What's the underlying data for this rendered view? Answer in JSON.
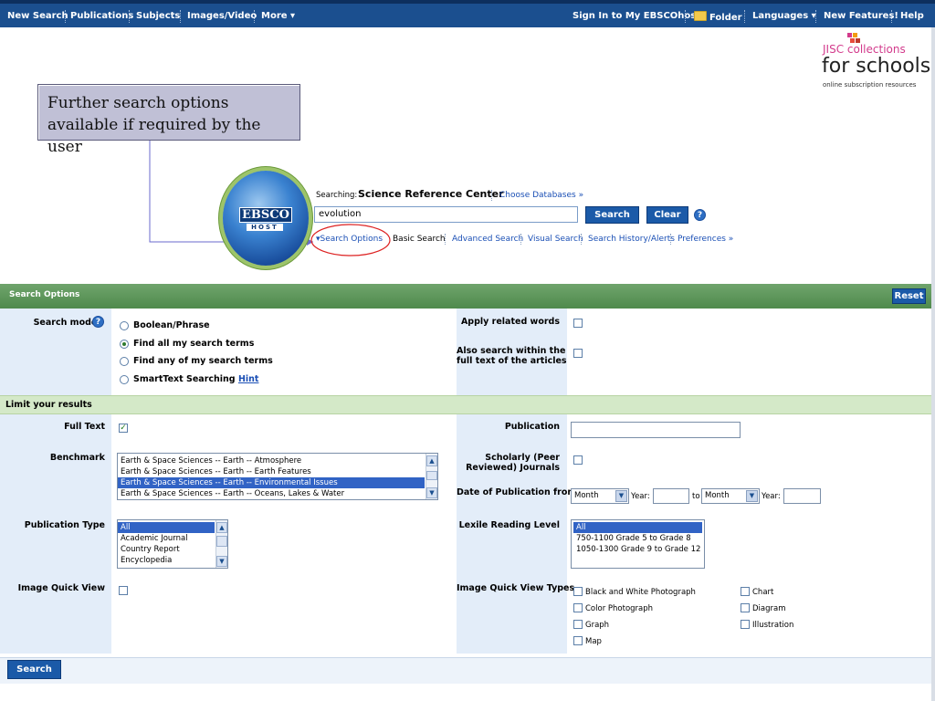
{
  "topnav": {
    "left": [
      "New Search",
      "Publications",
      "Subjects",
      "Images/Video",
      "More"
    ],
    "right": [
      "Sign In to My EBSCOhost",
      "Folder",
      "Languages",
      "New Features!",
      "Help"
    ]
  },
  "logo": {
    "line1": "JISC",
    "line1b": "collections",
    "line2": "for schools",
    "line3": "online subscription resources"
  },
  "callout": {
    "text": "Further search options available if required by the user"
  },
  "ebsco_logo": {
    "text": "EBSCO",
    "host": "HOST"
  },
  "search": {
    "searching_label": "Searching:",
    "database": "Science Reference Center",
    "choose_db": "Choose Databases »",
    "query": "evolution",
    "search_btn": "Search",
    "clear_btn": "Clear",
    "help": "?"
  },
  "sublinks": {
    "search_options": "Search Options",
    "basic": "Basic Search",
    "advanced": "Advanced Search",
    "visual": "Visual Search",
    "history": "Search History/Alerts",
    "preferences": "Preferences »"
  },
  "options_bar": {
    "title": "Search Options",
    "reset": "Reset"
  },
  "search_modes": {
    "label": "Search modes",
    "options": [
      "Boolean/Phrase",
      "Find all my search terms",
      "Find any of my search terms",
      "SmartText Searching"
    ],
    "selected_index": 1,
    "hint": "Hint"
  },
  "apply_related": {
    "label": "Apply related words",
    "checked": false
  },
  "also_search": {
    "label1": "Also search within the",
    "label2": "full text of the articles",
    "checked": false
  },
  "limit_bar": {
    "title": "Limit your results"
  },
  "full_text": {
    "label": "Full Text",
    "checked": true
  },
  "publication": {
    "label": "Publication",
    "value": ""
  },
  "benchmark": {
    "label": "Benchmark",
    "options": [
      "Earth & Space Sciences -- Earth -- Atmosphere",
      "Earth & Space Sciences -- Earth -- Earth Features",
      "Earth & Space Sciences -- Earth -- Environmental Issues",
      "Earth & Space Sciences -- Earth -- Oceans, Lakes & Water"
    ],
    "selected_index": 2
  },
  "scholarly": {
    "label1": "Scholarly (Peer",
    "label2": "Reviewed) Journals",
    "checked": false
  },
  "date_pub": {
    "label": "Date of Publication from",
    "month1": "Month",
    "year_label": "Year:",
    "to": "to",
    "month2": "Month",
    "year_label2": "Year:"
  },
  "pub_type": {
    "label": "Publication Type",
    "options": [
      "All",
      "Academic Journal",
      "Country Report",
      "Encyclopedia"
    ],
    "selected_index": 0
  },
  "lexile": {
    "label": "Lexile Reading Level",
    "options": [
      "All",
      "750-1100 Grade 5 to Grade 8",
      "1050-1300 Grade 9 to Grade 12"
    ],
    "selected_index": 0
  },
  "image_quick_view": {
    "label": "Image Quick View",
    "checked": false
  },
  "iqv_types": {
    "label": "Image Quick View Types",
    "left": [
      "Black and White Photograph",
      "Color Photograph",
      "Graph",
      "Map"
    ],
    "right": [
      "Chart",
      "Diagram",
      "Illustration"
    ]
  },
  "bottom": {
    "search_btn": "Search"
  }
}
